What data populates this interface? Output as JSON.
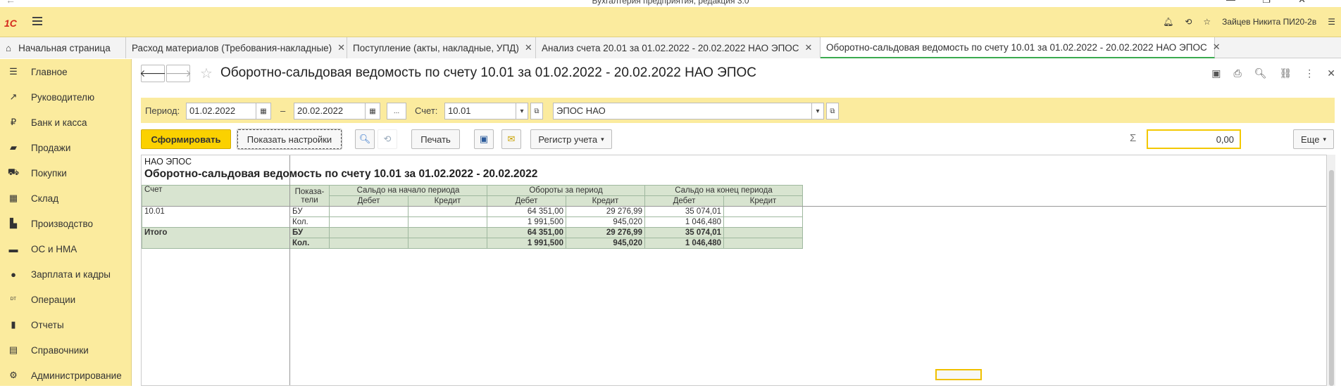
{
  "window": {
    "title": "Бухгалтерия предприятия, редакция 3.0"
  },
  "topbar": {
    "logo": "1С",
    "user": "Зайцев Никита ПИ20-2в"
  },
  "tabs": [
    {
      "label": "Начальная страница"
    },
    {
      "label": "Расход материалов (Требования-накладные)"
    },
    {
      "label": "Поступление (акты, накладные, УПД)"
    },
    {
      "label": "Анализ счета 20.01 за 01.02.2022 - 20.02.2022 НАО ЭПОС"
    },
    {
      "label": "Оборотно-сальдовая ведомость по счету 10.01 за 01.02.2022 - 20.02.2022 НАО ЭПОС"
    }
  ],
  "sidebar": {
    "items": [
      {
        "label": "Главное",
        "icon": "menu-lines-icon"
      },
      {
        "label": "Руководителю",
        "icon": "trend-icon"
      },
      {
        "label": "Банк и касса",
        "icon": "ruble-coin-icon"
      },
      {
        "label": "Продажи",
        "icon": "shopping-bag-icon"
      },
      {
        "label": "Покупки",
        "icon": "cart-icon"
      },
      {
        "label": "Склад",
        "icon": "warehouse-icon"
      },
      {
        "label": "Производство",
        "icon": "factory-icon"
      },
      {
        "label": "ОС и НМА",
        "icon": "truck-icon"
      },
      {
        "label": "Зарплата и кадры",
        "icon": "person-icon"
      },
      {
        "label": "Операции",
        "icon": "dt-kt-icon"
      },
      {
        "label": "Отчеты",
        "icon": "bar-chart-icon"
      },
      {
        "label": "Справочники",
        "icon": "books-icon"
      },
      {
        "label": "Администрирование",
        "icon": "gear-icon"
      }
    ]
  },
  "page": {
    "title": "Оборотно-сальдовая ведомость по счету 10.01 за 01.02.2022 - 20.02.2022 НАО ЭПОС"
  },
  "filters": {
    "period_label": "Период:",
    "date_from": "01.02.2022",
    "dash": "–",
    "date_to": "20.02.2022",
    "ellipsis": "...",
    "account_label": "Счет:",
    "account": "10.01",
    "org": "ЭПОС НАО"
  },
  "toolbar": {
    "generate": "Сформировать",
    "show_settings": "Показать настройки",
    "print": "Печать",
    "register": "Регистр учета",
    "sum_symbol": "Σ",
    "sum_value": "0,00",
    "more": "Еще"
  },
  "report": {
    "org": "НАО ЭПОС",
    "title": "Оборотно-сальдовая ведомость по счету 10.01 за 01.02.2022 - 20.02.2022",
    "headers": {
      "account": "Счет",
      "indicators": "Показа-\nтели",
      "opening": "Сальдо на начало периода",
      "turnover": "Обороты за период",
      "closing": "Сальдо на конец периода",
      "debit": "Дебет",
      "credit": "Кредит"
    },
    "rows": [
      {
        "account": "10.01",
        "indicator": "БУ",
        "open_dt": "",
        "open_kt": "",
        "turn_dt": "64 351,00",
        "turn_kt": "29 276,99",
        "close_dt": "35 074,01",
        "close_kt": ""
      },
      {
        "account": "",
        "indicator": "Кол.",
        "open_dt": "",
        "open_kt": "",
        "turn_dt": "1 991,500",
        "turn_kt": "945,020",
        "close_dt": "1 046,480",
        "close_kt": ""
      }
    ],
    "totals": [
      {
        "account": "Итого",
        "indicator": "БУ",
        "open_dt": "",
        "open_kt": "",
        "turn_dt": "64 351,00",
        "turn_kt": "29 276,99",
        "close_dt": "35 074,01",
        "close_kt": ""
      },
      {
        "account": "",
        "indicator": "Кол.",
        "open_dt": "",
        "open_kt": "",
        "turn_dt": "1 991,500",
        "turn_kt": "945,020",
        "close_dt": "1 046,480",
        "close_kt": ""
      }
    ]
  }
}
